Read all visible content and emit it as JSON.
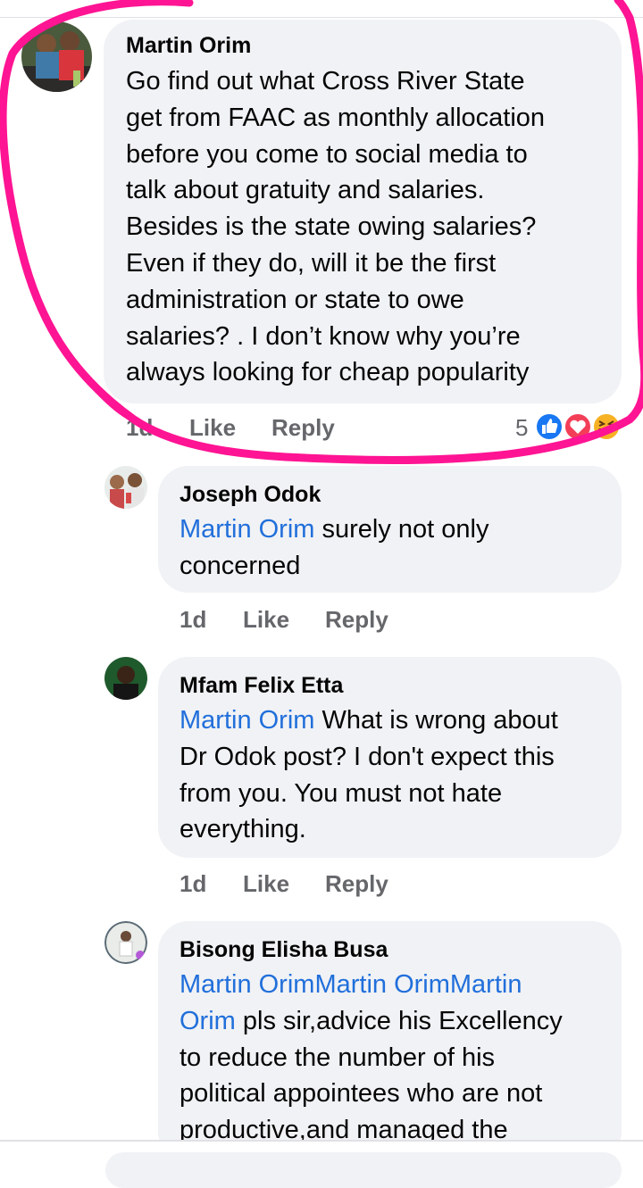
{
  "comments": [
    {
      "author": "Martin Orim",
      "mentions": "",
      "text": "Go find out what Cross River State get from FAAC as monthly allocation before you come to social media to talk about gratuity  and salaries. Besides is the state owing salaries? Even if they do, will it be the first administration or state to owe salaries? . I don’t know why you’re always looking for cheap popularity",
      "lines": [
        "Go find out what Cross River State",
        "get from FAAC as monthly allocation",
        "before you come to social media to",
        "talk about gratuity  and salaries.",
        "Besides is the state owing salaries?",
        "Even if they do, will it be the first",
        "administration or state to owe",
        "salaries? . I don’t know why you’re",
        "always looking for cheap popularity"
      ],
      "time": "1d",
      "like": "Like",
      "reply": "Reply",
      "reaction_count": "5",
      "reactions": [
        "like-icon",
        "love-icon",
        "haha-icon"
      ]
    },
    {
      "author": "Joseph Odok",
      "line1_mention": "Martin Orim",
      "line1_rest": " surely not only",
      "line2": "concerned",
      "time": "1d",
      "like": "Like",
      "reply": "Reply"
    },
    {
      "author": "Mfam Felix Etta",
      "line1_mention": "Martin Orim",
      "line1_rest": " What is wrong about",
      "line2": "Dr Odok post? I don't expect this",
      "line3": "from you. You must not hate",
      "line4": "everything.",
      "time": "1d",
      "like": "Like",
      "reply": "Reply"
    },
    {
      "author": "Bisong Elisha Busa",
      "line1_mention": "Martin OrimMartin OrimMartin",
      "line2_mention": "Orim",
      "line2_rest": " pls sir,advice his Excellency",
      "line3": "to reduce the number of his",
      "line4": "political appointees who are not",
      "line5": "productive,and managed the"
    }
  ],
  "colors": {
    "bubble": "#f0f2f5",
    "mention": "#216fdb",
    "meta": "#65676b",
    "annotation": "#ff1493"
  }
}
